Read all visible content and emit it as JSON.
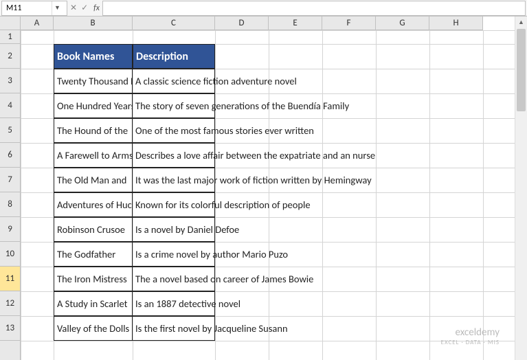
{
  "formula_bar": {
    "cell_reference": "M11",
    "fx_label": "fx",
    "formula_value": ""
  },
  "columns": [
    {
      "label": "A",
      "width": 48
    },
    {
      "label": "B",
      "width": 115
    },
    {
      "label": "C",
      "width": 120
    },
    {
      "label": "D",
      "width": 78
    },
    {
      "label": "E",
      "width": 78
    },
    {
      "label": "F",
      "width": 78
    },
    {
      "label": "G",
      "width": 78
    },
    {
      "label": "H",
      "width": 78
    }
  ],
  "rows": [
    {
      "label": "1",
      "height": 20
    },
    {
      "label": "2",
      "height": 36
    },
    {
      "label": "3",
      "height": 36
    },
    {
      "label": "4",
      "height": 36
    },
    {
      "label": "5",
      "height": 36
    },
    {
      "label": "6",
      "height": 36
    },
    {
      "label": "7",
      "height": 36
    },
    {
      "label": "8",
      "height": 36
    },
    {
      "label": "9",
      "height": 36
    },
    {
      "label": "10",
      "height": 36
    },
    {
      "label": "11",
      "height": 36
    },
    {
      "label": "12",
      "height": 36
    },
    {
      "label": "13",
      "height": 36
    }
  ],
  "active_row": "11",
  "headers": {
    "book_names": "Book Names",
    "description": "Description"
  },
  "table": [
    {
      "b": "Twenty Thousand Leagues",
      "c": "A classic science fiction adventure novel"
    },
    {
      "b": "One Hundred Years",
      "c": "The story of seven generations of the Buendía Family"
    },
    {
      "b": "The Hound of the",
      "c": "One of the most famous stories ever written"
    },
    {
      "b": "A Farewell to Arms",
      "c": "Describes a love affair between the expatriate and an nurse"
    },
    {
      "b": "The Old Man and",
      "c": "It was the last major work of fiction written by Hemingway"
    },
    {
      "b": "Adventures of Huck",
      "c": "Known for its colorful description of people"
    },
    {
      "b": "Robinson Crusoe",
      "c": "Is a novel by Daniel Defoe"
    },
    {
      "b": "The Godfather",
      "c": "Is a crime novel by author Mario Puzo"
    },
    {
      "b": "The Iron Mistress",
      "c": "The a novel based on career of James Bowie"
    },
    {
      "b": "A Study in Scarlet",
      "c": "Is an 1887 detective novel"
    },
    {
      "b": "Valley of the Dolls",
      "c": "Is the first novel by Jacqueline Susann"
    }
  ],
  "watermark": {
    "main": "exceldemy",
    "sub": "EXCEL · DATA · MIS"
  }
}
